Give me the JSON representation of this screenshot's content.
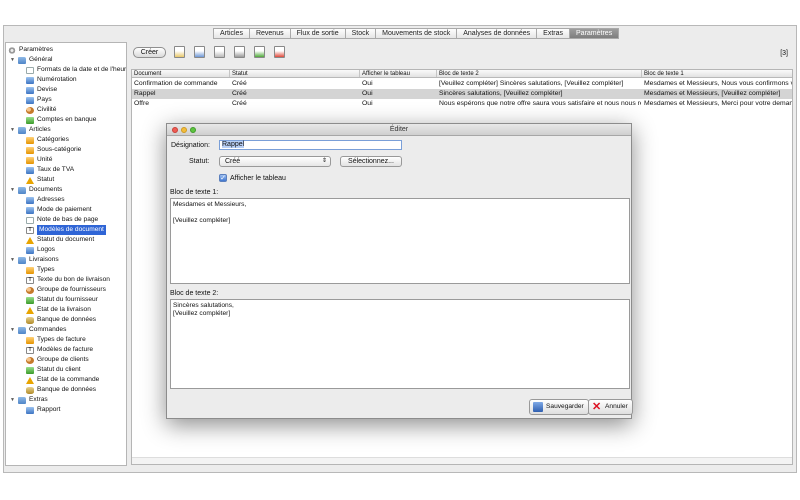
{
  "colors": {
    "accent": "#2f65d6",
    "active_tab": "#8a8a8a",
    "selected_row": "#d4d4d4",
    "close": "#ee5b52",
    "minimize": "#f3bd3b",
    "maximize": "#5fc440"
  },
  "tabs": [
    {
      "label": "Articles"
    },
    {
      "label": "Revenus"
    },
    {
      "label": "Flux de sortie"
    },
    {
      "label": "Stock"
    },
    {
      "label": "Mouvements de stock"
    },
    {
      "label": "Analyses de données"
    },
    {
      "label": "Extras"
    },
    {
      "label": "Paramètres",
      "active": true
    }
  ],
  "sidebar": {
    "root": "Paramètres",
    "nodes": [
      {
        "label": "Général",
        "depth": 1,
        "icon": "folder-icon",
        "toggle": true
      },
      {
        "label": "Formats de la date et de l'heure",
        "depth": 2,
        "icon": "calendar-icon"
      },
      {
        "label": "Numérotation",
        "depth": 2,
        "icon": "numbering-icon"
      },
      {
        "label": "Devise",
        "depth": 2,
        "icon": "currency-icon"
      },
      {
        "label": "Pays",
        "depth": 2,
        "icon": "globe-icon"
      },
      {
        "label": "Civilité",
        "depth": 2,
        "icon": "people-icon"
      },
      {
        "label": "Comptes en banque",
        "depth": 2,
        "icon": "bank-icon"
      },
      {
        "label": "Articles",
        "depth": 1,
        "icon": "folder-icon",
        "toggle": true
      },
      {
        "label": "Catégories",
        "depth": 2,
        "icon": "category-icon"
      },
      {
        "label": "Sous-catégorie",
        "depth": 2,
        "icon": "subcategory-icon"
      },
      {
        "label": "Unité",
        "depth": 2,
        "icon": "unit-icon"
      },
      {
        "label": "Taux de TVA",
        "depth": 2,
        "icon": "percent-icon"
      },
      {
        "label": "Statut",
        "depth": 2,
        "icon": "warning-icon"
      },
      {
        "label": "Documents",
        "depth": 1,
        "icon": "folder-icon",
        "toggle": true
      },
      {
        "label": "Adresses",
        "depth": 2,
        "icon": "address-icon"
      },
      {
        "label": "Mode de paiement",
        "depth": 2,
        "icon": "payment-icon"
      },
      {
        "label": "Note de bas de page",
        "depth": 2,
        "icon": "footnote-icon"
      },
      {
        "label": "Modèles de document",
        "depth": 2,
        "icon": "template-icon",
        "selected": true
      },
      {
        "label": "Statut du document",
        "depth": 2,
        "icon": "warning-icon"
      },
      {
        "label": "Logos",
        "depth": 2,
        "icon": "logo-icon"
      },
      {
        "label": "Livraisons",
        "depth": 1,
        "icon": "folder-icon",
        "toggle": true
      },
      {
        "label": "Types",
        "depth": 2,
        "icon": "types-icon"
      },
      {
        "label": "Texte du bon de livraison",
        "depth": 2,
        "icon": "text-icon"
      },
      {
        "label": "Groupe de fournisseurs",
        "depth": 2,
        "icon": "group-icon"
      },
      {
        "label": "Statut du fournisseur",
        "depth": 2,
        "icon": "supplier-status-icon"
      },
      {
        "label": "Etat de la livraison",
        "depth": 2,
        "icon": "warning-icon"
      },
      {
        "label": "Banque de données",
        "depth": 2,
        "icon": "database-icon"
      },
      {
        "label": "Commandes",
        "depth": 1,
        "icon": "folder-icon",
        "toggle": true
      },
      {
        "label": "Types de facture",
        "depth": 2,
        "icon": "types-icon"
      },
      {
        "label": "Modèles de facture",
        "depth": 2,
        "icon": "text-icon"
      },
      {
        "label": "Groupe de clients",
        "depth": 2,
        "icon": "group-icon"
      },
      {
        "label": "Statut du client",
        "depth": 2,
        "icon": "client-status-icon"
      },
      {
        "label": "Etat de la commande",
        "depth": 2,
        "icon": "warning-icon"
      },
      {
        "label": "Banque de données",
        "depth": 2,
        "icon": "database-icon"
      },
      {
        "label": "Extras",
        "depth": 1,
        "icon": "folder-icon",
        "toggle": true
      },
      {
        "label": "Rapport",
        "depth": 2,
        "icon": "report-icon"
      }
    ]
  },
  "toolbar": {
    "create_label": "Créer",
    "icons": [
      "new-document-icon",
      "copy-icon",
      "paste-icon",
      "print-icon",
      "export-icon",
      "pdf-icon"
    ],
    "count": "[3]"
  },
  "table": {
    "columns": [
      "Document",
      "Statut",
      "Afficher le tableau",
      "Bloc de texte 2",
      "Bloc de texte 1"
    ],
    "rows": [
      {
        "cells": [
          "Confirmation de commande",
          "Créé",
          "Oui",
          "[Veuillez compléter]  Sincères salutations, [Veuillez compléter]",
          "Mesdames et Messieurs,  Nous vous confirmons vo"
        ]
      },
      {
        "cells": [
          "Rappel",
          "Créé",
          "Oui",
          "Sincères salutations, [Veuillez compléter]",
          "Mesdames et Messieurs,  [Veuillez compléter]"
        ],
        "selected": true
      },
      {
        "cells": [
          "Offre",
          "Créé",
          "Oui",
          "Nous espérons que notre offre saura vous satisfaire et nous nous ré...",
          "Mesdames et Messieurs,  Merci pour votre demand"
        ]
      }
    ]
  },
  "dialog": {
    "title": "Éditer",
    "designation_label": "Désignation:",
    "designation_value": "Rappel",
    "statut_label": "Statut:",
    "statut_value": "Créé",
    "select_button": "Sélectionnez...",
    "checkbox_label": "Afficher le tableau",
    "block1_label": "Bloc de texte 1:",
    "block1_text": "Mesdames et Messieurs,\n\n[Veuillez compléter]",
    "block2_label": "Bloc de texte 2:",
    "block2_text": "Sincères salutations,\n[Veuillez compléter]",
    "save_label": "Sauvegarder",
    "cancel_label": "Annuler"
  }
}
